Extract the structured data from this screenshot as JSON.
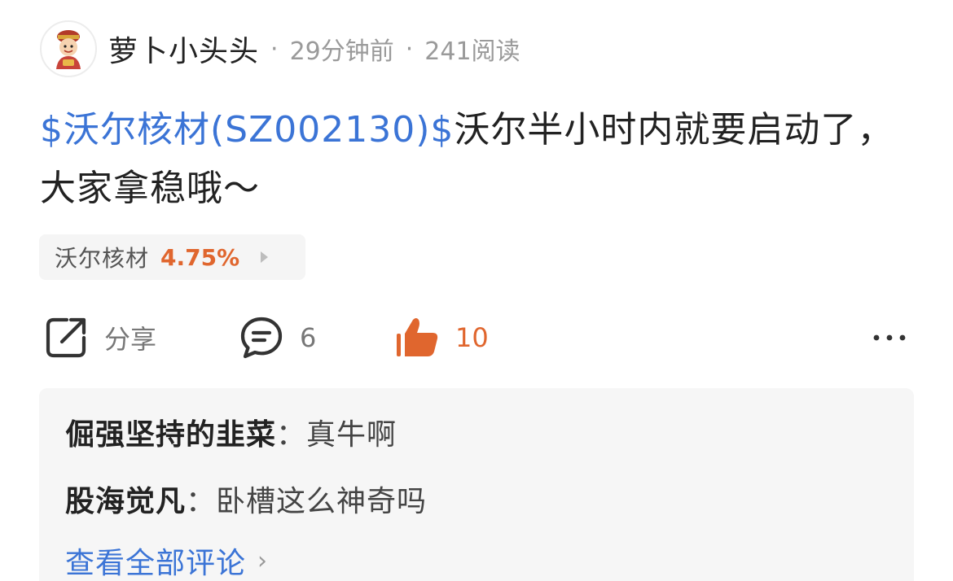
{
  "post": {
    "author": "萝卜小头头",
    "time": "29分钟前",
    "reads": "241阅读",
    "separator": "·",
    "stock_link": "$沃尔核材(SZ002130)$",
    "text": "沃尔半小时内就要启动了，大家拿稳哦～"
  },
  "stock_chip": {
    "name": "沃尔核材",
    "change": "4.75%"
  },
  "actions": {
    "share_label": "分享",
    "comment_count": "6",
    "like_count": "10"
  },
  "comments": [
    {
      "user": "倔强坚持的韭菜",
      "sep": "：",
      "text": "真牛啊"
    },
    {
      "user": "股海觉凡",
      "sep": "：",
      "text": "卧槽这么神奇吗"
    }
  ],
  "view_all_label": "查看全部评论",
  "colors": {
    "link_blue": "#3b74d6",
    "accent_orange": "#e0662e",
    "muted_gray": "#9a9a9a",
    "panel_bg": "#f6f6f6"
  },
  "icons": {
    "avatar": "avatar-icon",
    "share": "share-icon",
    "comment": "comment-icon",
    "like": "thumbs-up-icon",
    "more": "more-icon"
  }
}
